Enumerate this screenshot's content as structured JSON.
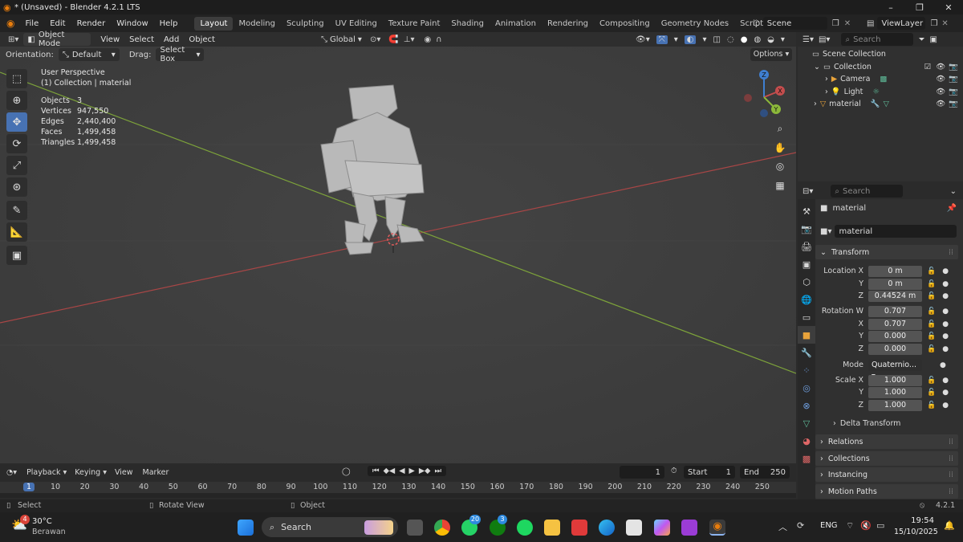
{
  "window": {
    "title": "* (Unsaved) - Blender 4.2.1 LTS"
  },
  "menus": [
    "File",
    "Edit",
    "Render",
    "Window",
    "Help"
  ],
  "workspaces": [
    "Layout",
    "Modeling",
    "Sculpting",
    "UV Editing",
    "Texture Paint",
    "Shading",
    "Animation",
    "Rendering",
    "Compositing",
    "Geometry Nodes",
    "Scripting"
  ],
  "active_workspace": "Layout",
  "add_workspace": "+",
  "scene": "Scene",
  "view_layer": "ViewLayer",
  "viewport_header": {
    "mode": "Object Mode",
    "menus": [
      "View",
      "Select",
      "Add",
      "Object"
    ],
    "transform": "Global",
    "orientation_label": "Orientation:",
    "orientation_value": "Default",
    "drag_label": "Drag:",
    "drag_value": "Select Box",
    "options": "Options"
  },
  "viewport_info": {
    "perspective": "User Perspective",
    "collection": "(1) Collection | material",
    "stats": [
      {
        "label": "Objects",
        "value": "3"
      },
      {
        "label": "Vertices",
        "value": "947,550"
      },
      {
        "label": "Edges",
        "value": "2,440,400"
      },
      {
        "label": "Faces",
        "value": "1,499,458"
      },
      {
        "label": "Triangles",
        "value": "1,499,458"
      }
    ]
  },
  "gizmo": {
    "z": "Z",
    "x": "X",
    "y": "Y"
  },
  "outliner": {
    "search_placeholder": "Search",
    "items": [
      {
        "label": "Scene Collection"
      },
      {
        "label": "Collection"
      },
      {
        "label": "Camera"
      },
      {
        "label": "Light"
      },
      {
        "label": "material"
      }
    ]
  },
  "properties": {
    "search_placeholder": "Search",
    "object_name": "material",
    "datablock": "material",
    "transform_title": "Transform",
    "rows": [
      {
        "label": "Location X",
        "value": "0 m"
      },
      {
        "label": "Y",
        "value": "0 m"
      },
      {
        "label": "Z",
        "value": "0.44524 m"
      },
      {
        "label": "Rotation W",
        "value": "0.707"
      },
      {
        "label": "X",
        "value": "0.707"
      },
      {
        "label": "Y",
        "value": "0.000"
      },
      {
        "label": "Z",
        "value": "0.000"
      },
      {
        "label": "Mode",
        "value": "Quaternio..."
      },
      {
        "label": "Scale X",
        "value": "1.000"
      },
      {
        "label": "Y",
        "value": "1.000"
      },
      {
        "label": "Z",
        "value": "1.000"
      }
    ],
    "delta_transform": "Delta Transform",
    "sections": [
      "Relations",
      "Collections",
      "Instancing",
      "Motion Paths"
    ]
  },
  "timeline": {
    "menus": [
      "Playback",
      "Keying",
      "View",
      "Marker"
    ],
    "current_frame": "1",
    "start_label": "Start",
    "start": "1",
    "end_label": "End",
    "end": "250",
    "ticks": [
      "1",
      "10",
      "20",
      "30",
      "40",
      "50",
      "60",
      "70",
      "80",
      "90",
      "100",
      "110",
      "120",
      "130",
      "140",
      "150",
      "160",
      "170",
      "180",
      "190",
      "200",
      "210",
      "220",
      "230",
      "240",
      "250"
    ]
  },
  "statusbar": {
    "select": "Select",
    "rotate": "Rotate View",
    "object": "Object",
    "version": "4.2.1"
  },
  "taskbar": {
    "weather_temp": "30°C",
    "weather_desc": "Berawan",
    "weather_badge": "4",
    "search": "Search",
    "whatsapp_badge": "20",
    "xbox_badge": "3",
    "lang": "ENG",
    "time": "19:54",
    "date": "15/10/2025"
  },
  "colors": {
    "accent": "#4772b3",
    "x_axis": "#c44d4d",
    "y_axis": "#8cb83a",
    "z_axis": "#3f7fd1"
  }
}
